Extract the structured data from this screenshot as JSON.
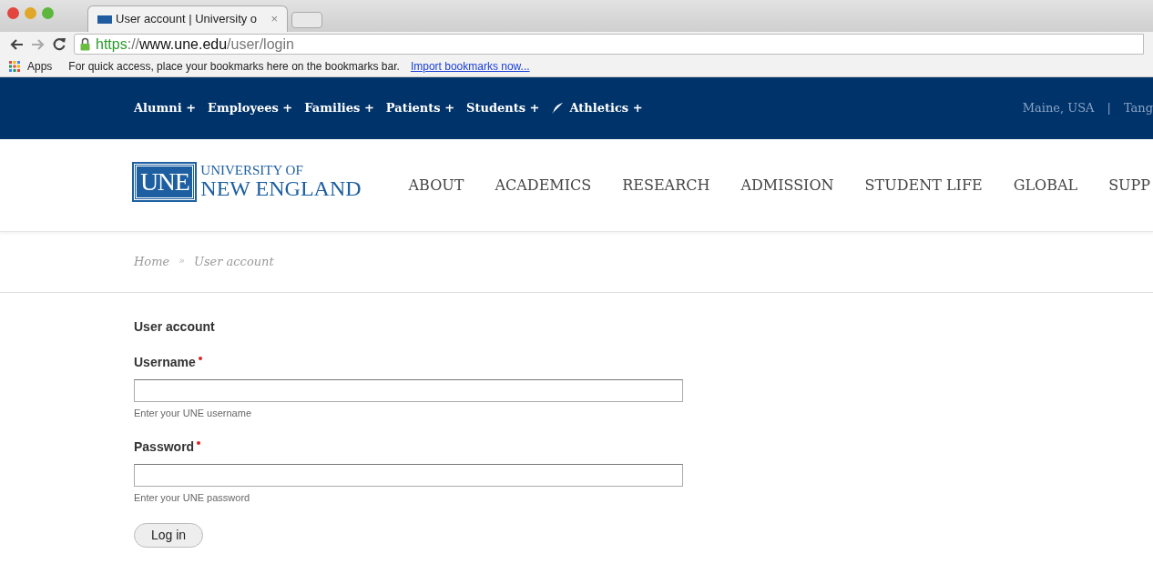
{
  "browser": {
    "tab": {
      "title": "User account | University o",
      "close": "×"
    },
    "url": {
      "scheme": "https",
      "separator": "://",
      "host": "www.une.edu",
      "path": "/user/login"
    },
    "bookmarks_bar": {
      "apps": "Apps",
      "message": "For quick access, place your bookmarks here on the bookmarks bar.",
      "link": "Import bookmarks now..."
    }
  },
  "utility_nav": {
    "items": [
      {
        "label": "Alumni +",
        "icon": false
      },
      {
        "label": "Employees +",
        "icon": false
      },
      {
        "label": "Families +",
        "icon": false
      },
      {
        "label": "Patients +",
        "icon": false
      },
      {
        "label": "Students +",
        "icon": false
      },
      {
        "label": "Athletics +",
        "icon": true
      }
    ],
    "right": [
      "Maine, USA",
      "|",
      "Tang"
    ]
  },
  "logo": {
    "mark": "UNE",
    "line_1": "UNIVERSITY OF",
    "line_2": "NEW ENGLAND"
  },
  "main_nav": [
    "ABOUT",
    "ACADEMICS",
    "RESEARCH",
    "ADMISSION",
    "STUDENT LIFE",
    "GLOBAL",
    "SUPP"
  ],
  "breadcrumb": [
    "Home",
    "»",
    "User account"
  ],
  "form": {
    "title": "User account",
    "fields": [
      {
        "label": "Username",
        "required": true,
        "description": "Enter your UNE username"
      },
      {
        "label": "Password",
        "required": true,
        "description": "Enter your UNE password"
      }
    ],
    "submit": "Log in"
  }
}
